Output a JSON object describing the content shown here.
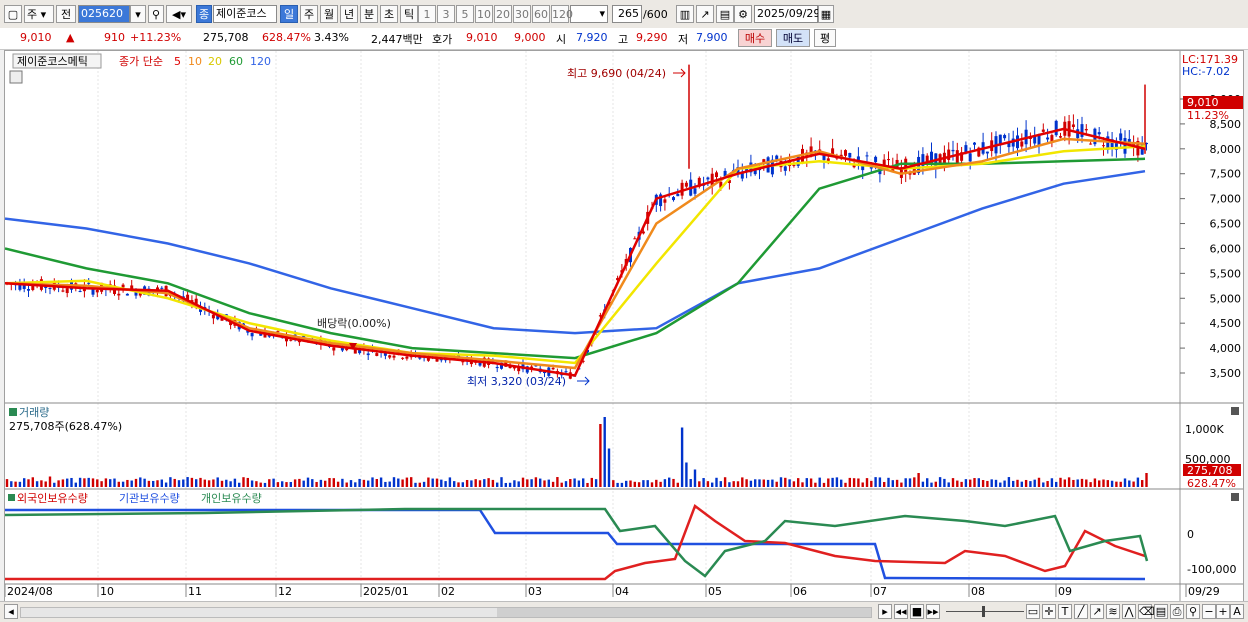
{
  "toolbar": {
    "market": "주",
    "scope": "전",
    "code": "025620",
    "name_badge": "종",
    "stock_name": "제이준코스",
    "period_tabs": [
      "일",
      "주",
      "월",
      "년",
      "분",
      "초",
      "틱"
    ],
    "selected_period": "일",
    "intervals": [
      "1",
      "3",
      "5",
      "10",
      "20",
      "30",
      "60",
      "120"
    ],
    "count": "265",
    "count_max": "/600",
    "date": "2025/09/29"
  },
  "quote": {
    "price": "9,010",
    "change": "910",
    "change_pct": "+11.23%",
    "volume": "275,708",
    "volume_ratio": "628.47%",
    "turnover": "3.43%",
    "amount": "2,447백만",
    "bid_label": "호가",
    "bid": "9,010",
    "ask": "9,000",
    "open_label": "시",
    "open": "7,920",
    "high_label": "고",
    "high": "9,290",
    "low_label": "저",
    "low": "7,900",
    "buy_label": "매수",
    "sell_label": "매도",
    "eval_label": "평"
  },
  "colors": {
    "up": "#d00000",
    "down": "#0033cc",
    "ma5": "#e00000",
    "ma10": "#f08a1c",
    "ma20": "#f2e600",
    "ma60": "#1f9a34",
    "ma120": "#3264e6",
    "foreign": "#e02020",
    "institution": "#2050e0",
    "individual": "#2a8a52"
  },
  "price_panel": {
    "title": "제이준코스메틱",
    "ma_label": "종가 단순",
    "ma_periods": [
      "5",
      "10",
      "20",
      "60",
      "120"
    ],
    "lc_label": "LC:171.39",
    "hc_label": "HC:-7.02",
    "high_annotation": "최고 9,690 (04/24)",
    "low_annotation": "최저 3,320 (03/24)",
    "dividend_annotation": "배당락(0.00%)",
    "current_price": "9,010",
    "current_change": "11.23%",
    "y_ticks": [
      "9,000",
      "8,500",
      "8,000",
      "7,500",
      "7,000",
      "6,500",
      "6,000",
      "5,500",
      "5,000",
      "4,500",
      "4,000",
      "3,500"
    ]
  },
  "volume_panel": {
    "title": "거래량",
    "value_label": "275,708주(628.47%)",
    "y_ticks": [
      "1,000K",
      "500,000"
    ],
    "current_volume": "275,708",
    "current_ratio": "628.47%"
  },
  "holdings_panel": {
    "legend": [
      "외국인보유수량",
      "기관보유수량",
      "개인보유수량"
    ],
    "y_ticks": [
      "0",
      "-100,000"
    ]
  },
  "x_axis": {
    "labels": [
      "2024/08",
      "10",
      "11",
      "12",
      "2025/01",
      "02",
      "03",
      "04",
      "05",
      "06",
      "07",
      "08",
      "09",
      "09/29"
    ]
  },
  "chart_data": {
    "type": "line",
    "title": "제이준코스메틱",
    "x": [
      "2024/08",
      "10",
      "11",
      "12",
      "2025/01",
      "02",
      "03",
      "04",
      "05",
      "06",
      "07",
      "08",
      "09",
      "09/29"
    ],
    "ylim": [
      3320,
      9690
    ],
    "series": [
      {
        "name": "5",
        "values": [
          5300,
          5200,
          5150,
          4350,
          4050,
          3850,
          3700,
          3450,
          7000,
          7500,
          7900,
          7600,
          8000,
          8400,
          8000
        ]
      },
      {
        "name": "10",
        "values": [
          5300,
          5250,
          5100,
          4400,
          4100,
          3900,
          3750,
          3600,
          6500,
          7600,
          7950,
          7500,
          7750,
          8200,
          8100
        ]
      },
      {
        "name": "20",
        "values": [
          5300,
          5350,
          5000,
          4500,
          4150,
          3900,
          3850,
          3700,
          5700,
          7600,
          7750,
          7600,
          7700,
          7950,
          8050
        ]
      },
      {
        "name": "60",
        "values": [
          6000,
          5600,
          5300,
          4700,
          4300,
          4000,
          3900,
          3800,
          4300,
          5300,
          7200,
          7700,
          7700,
          7750,
          7800
        ]
      },
      {
        "name": "120",
        "values": [
          6600,
          6400,
          6100,
          5700,
          5200,
          4800,
          4400,
          4300,
          4400,
          5300,
          5600,
          6200,
          6800,
          7300,
          7550
        ]
      }
    ]
  }
}
